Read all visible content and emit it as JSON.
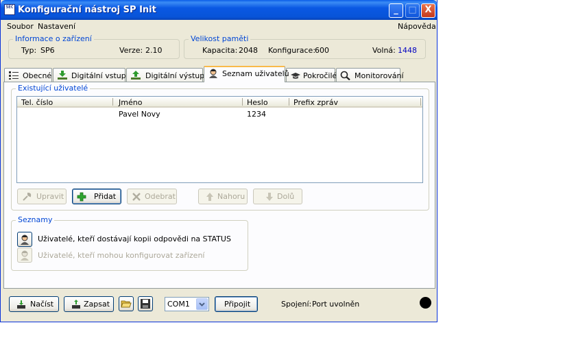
{
  "window": {
    "title": "Konfigurační nástroj SP Init",
    "app_icon": "SEC"
  },
  "titlebar_buttons": {
    "minimize": "_",
    "maximize": "□",
    "close": "X"
  },
  "menu": {
    "file": "Soubor",
    "settings": "Nastavení",
    "help": "Nápověda"
  },
  "device_info": {
    "legend": "Informace o zařízení",
    "type_label": "Typ:",
    "type_value": "SP6",
    "version_label": "Verze:",
    "version_value": "2.10"
  },
  "memory": {
    "legend": "Velikost paměti",
    "capacity_label": "Kapacita:",
    "capacity_value": "2048",
    "config_label": "Konfigurace:",
    "config_value": "600",
    "free_label": "Volná:",
    "free_value": "1448"
  },
  "tabs": [
    {
      "label": "Obecné",
      "icon": "list-icon"
    },
    {
      "label": "Digitální vstupy",
      "icon": "download-icon"
    },
    {
      "label": "Digitální výstupy",
      "icon": "upload-icon"
    },
    {
      "label": "Seznam uživatelů",
      "icon": "user-icon",
      "active": true
    },
    {
      "label": "Pokročilé",
      "icon": "graduation-cap-icon"
    },
    {
      "label": "Monitorování",
      "icon": "magnifier-icon"
    }
  ],
  "users": {
    "legend": "Existující uživatelé",
    "columns": [
      "Tel. číslo",
      "Jméno",
      "Heslo",
      "Prefix zpráv"
    ],
    "rows": [
      {
        "phone": "",
        "name": "Pavel Novy",
        "password": "1234",
        "prefix": ""
      }
    ],
    "buttons": {
      "edit": "Upravit",
      "add": "Přidat",
      "delete": "Odebrat",
      "up": "Nahoru",
      "down": "Dolů"
    }
  },
  "lists": {
    "legend": "Seznamy",
    "status_copy": "Uživatelé, kteří dostávají kopii odpovědi na STATUS",
    "can_configure": "Uživatelé, kteří mohou konfigurovat zařízení"
  },
  "bottom": {
    "load": "Načíst",
    "write": "Zapsat",
    "port": "COM1",
    "connect": "Připojit",
    "connection_label": "Spojení:",
    "connection_value": "Port uvolněn"
  },
  "colors": {
    "accent": "#0046d5",
    "title_bar": "#0a58e3",
    "free_value": "#0000c0"
  }
}
